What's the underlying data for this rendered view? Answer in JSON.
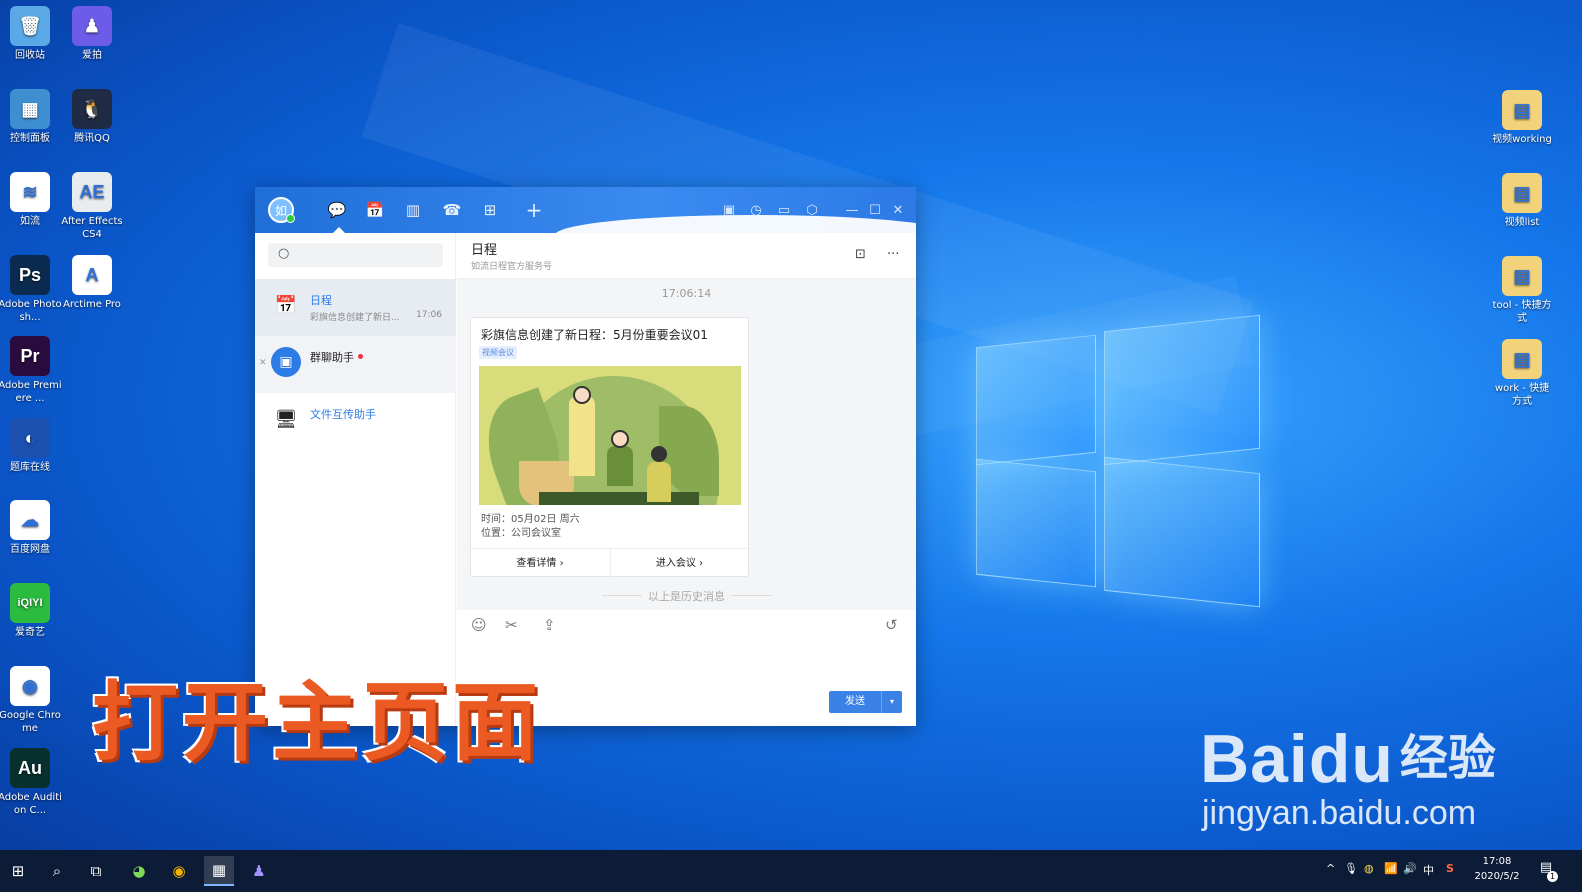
{
  "desktop": {
    "icons_left": [
      {
        "label": "回收站",
        "glyph": "🗑",
        "bg": "#5aa9e6"
      },
      {
        "label": "爱拍",
        "glyph": "♟",
        "bg": "#6c5ce7"
      },
      {
        "label": "控制面板",
        "glyph": "▦",
        "bg": "#3d8fd1"
      },
      {
        "label": "腾讯QQ",
        "glyph": "🐧",
        "bg": "#1f2a44"
      },
      {
        "label": "如流",
        "glyph": "≋",
        "bg": "#ffffff"
      },
      {
        "label": "After Effects CS4",
        "glyph": "AE",
        "bg": "#e9ecef"
      },
      {
        "label": "Adobe Photosh...",
        "glyph": "Ps",
        "bg": "#0a2a4f"
      },
      {
        "label": "Arctime Pro",
        "glyph": "A",
        "bg": "#ffffff"
      },
      {
        "label": "Adobe Premiere ...",
        "glyph": "Pr",
        "bg": "#2a0b3d"
      },
      {
        "label": "题库在线",
        "glyph": "◐",
        "bg": "#1b4fb0"
      },
      {
        "label": "百度网盘",
        "glyph": "☁",
        "bg": "#ffffff"
      },
      {
        "label": "爱奇艺",
        "glyph": "iQIYI",
        "bg": "#2abb3f"
      },
      {
        "label": "Google Chrome",
        "glyph": "◉",
        "bg": "#ffffff"
      },
      {
        "label": "Adobe Audition C...",
        "glyph": "Au",
        "bg": "#07302f"
      }
    ],
    "icons_right": [
      {
        "label": "视频working",
        "glyph": "▤",
        "bg": "#f2d27a"
      },
      {
        "label": "视频list",
        "glyph": "▤",
        "bg": "#f2d27a"
      },
      {
        "label": "tool - 快捷方式",
        "glyph": "▤",
        "bg": "#f2d27a"
      },
      {
        "label": "work - 快捷方式",
        "glyph": "▤",
        "bg": "#f2d27a"
      }
    ]
  },
  "window": {
    "avatar_text": "如",
    "tabs": [
      "💬",
      "📅",
      "▥",
      "☎",
      "⊞",
      "+"
    ],
    "title_tools": [
      "▣",
      "◷",
      "▭",
      "⬡"
    ],
    "controls": [
      "—",
      "☐",
      "✕"
    ],
    "search": {
      "placeholder": "",
      "icon": "○"
    },
    "conversations": [
      {
        "name": "日程",
        "preview": "彩旗信息创建了新日...",
        "time": "17:06",
        "icon": "📅"
      },
      {
        "name": "群聊助手",
        "preview": "",
        "time": "",
        "icon": "▣",
        "unread": true
      },
      {
        "name": "文件互传助手",
        "preview": "",
        "time": "",
        "icon": "🖥"
      }
    ],
    "chat": {
      "title": "日程",
      "subtitle": "如流日程官方服务号",
      "timestamp": "17:06:14",
      "card": {
        "title": "彩旗信息创建了新日程：5月份重要会议01",
        "tag": "视频会议",
        "time_line": "时间：05月02日 周六",
        "place_line": "位置：公司会议室",
        "action_detail": "查看详情 ›",
        "action_join": "进入会议 ›"
      },
      "history_label": "以上是历史消息",
      "toolbar": [
        "☺",
        "✂",
        "⇪",
        "↺"
      ],
      "send_label": "发送",
      "send_arrow": "▾",
      "header_icons": [
        "⊡",
        "···"
      ]
    }
  },
  "caption": "打开主页面",
  "watermark": {
    "brand": "Bai",
    "brand2": "du",
    "cn": "经验",
    "url": "jingyan.baidu.com"
  },
  "taskbar": {
    "start": "⊞",
    "search": "⌕",
    "taskview": "⧉",
    "apps": [
      "◕",
      "◉",
      "▦",
      "♟"
    ],
    "tray": [
      "^",
      "🎙",
      "◍",
      "📶",
      "🔊",
      "中",
      "S"
    ],
    "time": "17:08",
    "date": "2020/5/2",
    "notif": "▤",
    "notif_count": "1"
  }
}
